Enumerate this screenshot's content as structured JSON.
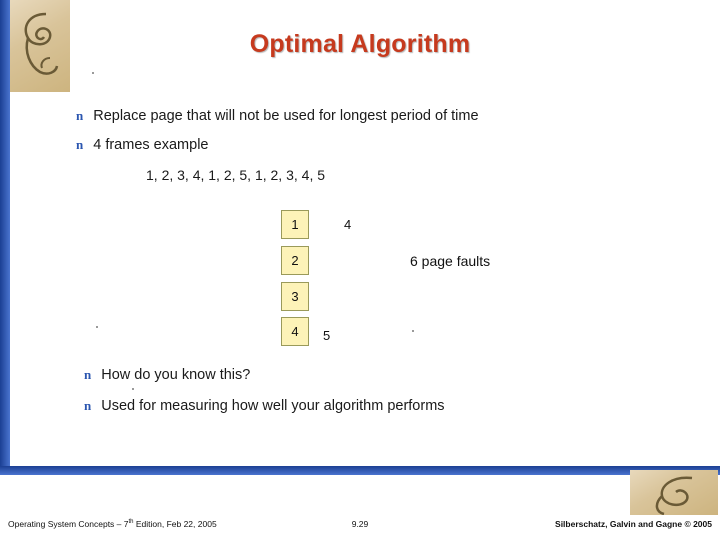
{
  "slide": {
    "title": "Optimal Algorithm",
    "bullets": [
      {
        "marker": "n",
        "text": "Replace page that will not be used for longest period of time"
      },
      {
        "marker": "n",
        "text": "4 frames example"
      },
      {
        "marker": "n",
        "text": "How do you know this?"
      },
      {
        "marker": "n",
        "text": "Used for measuring how well your algorithm performs"
      }
    ],
    "reference_string": "1, 2, 3, 4, 1, 2, 5, 1, 2, 3, 4, 5",
    "frames": [
      "1",
      "2",
      "3",
      "4"
    ],
    "loose_numbers": {
      "top": "4",
      "bottom": "5"
    },
    "fault_label": "6 page faults"
  },
  "footer": {
    "left_prefix": "Operating System Concepts – 7",
    "left_sup": "th",
    "left_suffix": " Edition, Feb 22, 2005",
    "center": "9.29",
    "right": "Silberschatz, Galvin and Gagne © 2005"
  },
  "colors": {
    "title": "#c63a1e",
    "band": "#2b56b0",
    "frame_fill": "#fdf3b8"
  }
}
